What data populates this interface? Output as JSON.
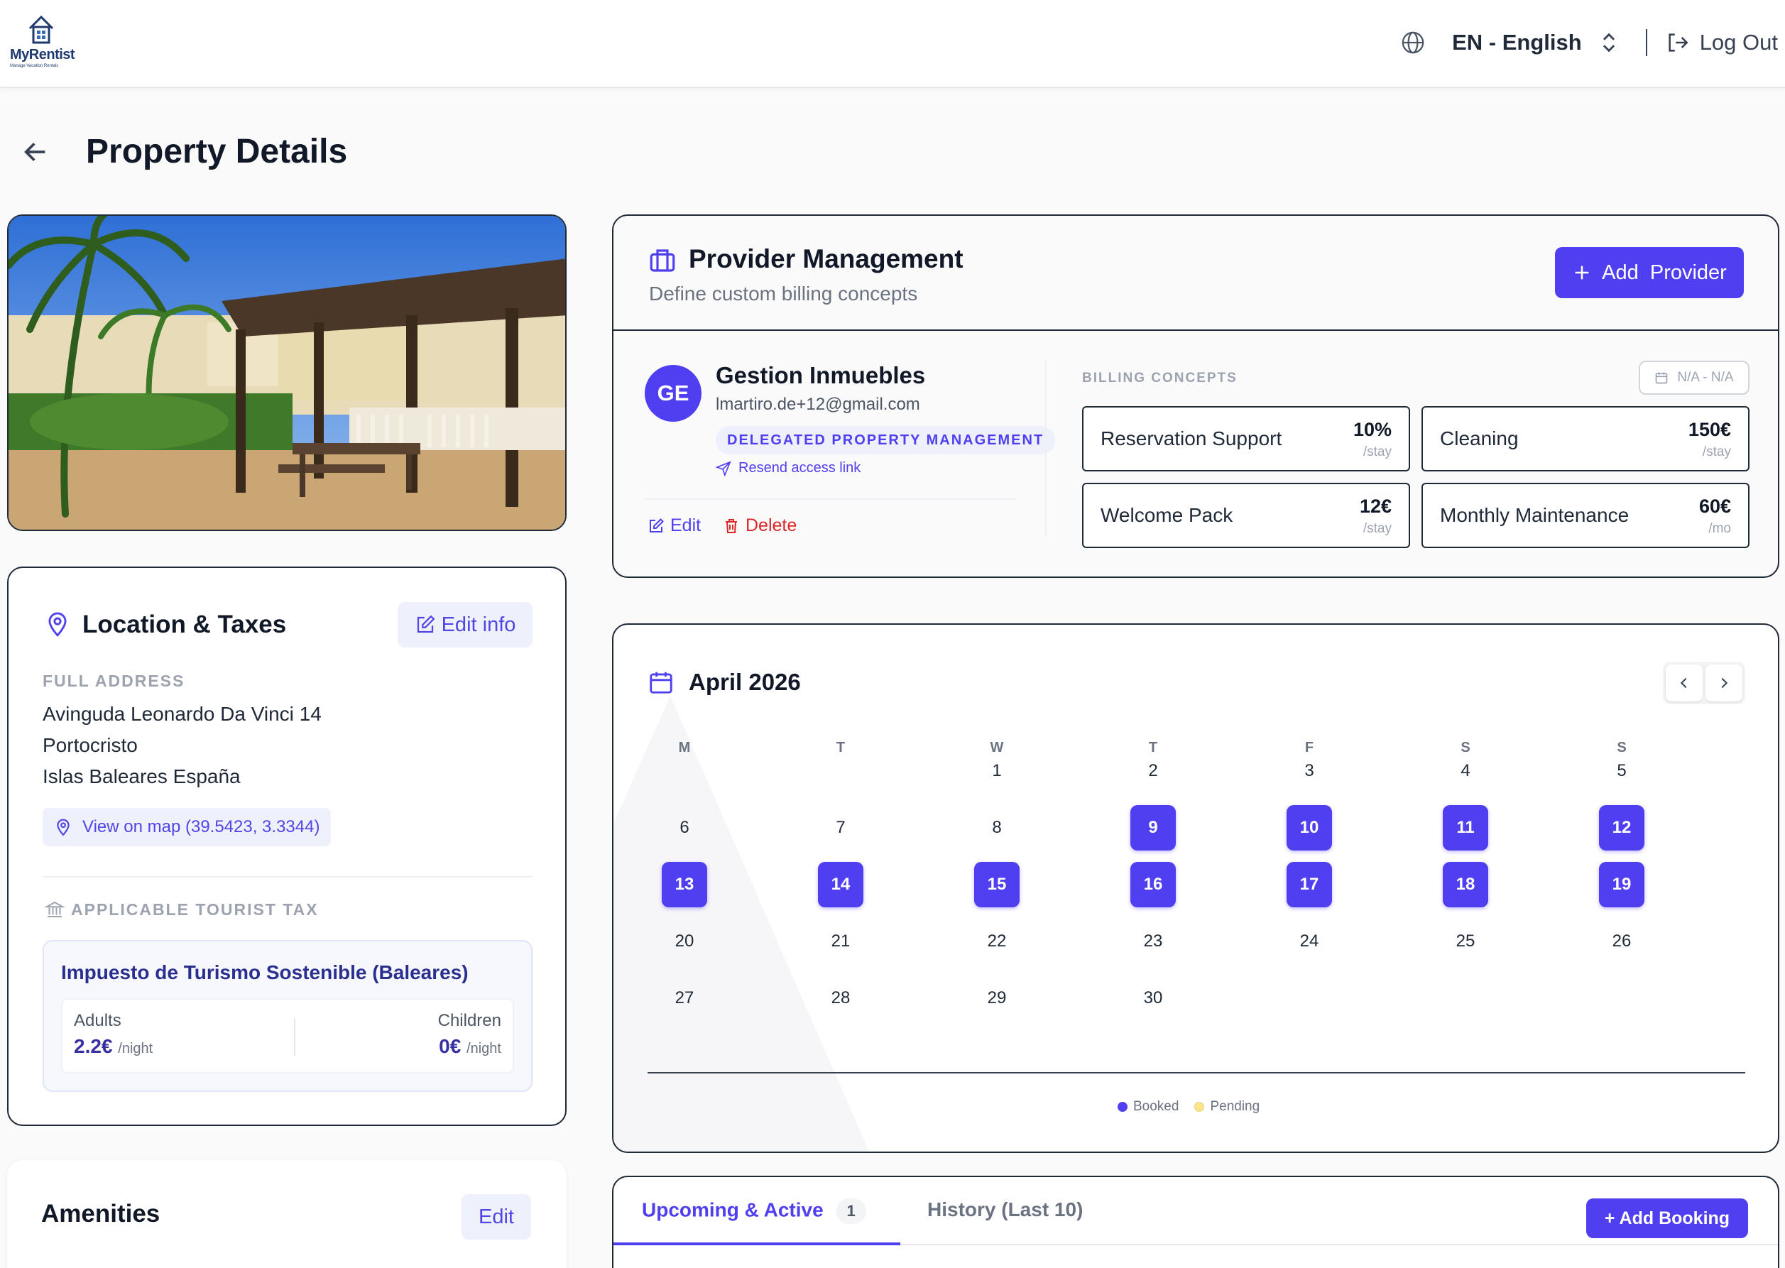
{
  "app": {
    "brand": "MyRentist",
    "tagline": "Manage Vacation Rentals",
    "language": "EN - English",
    "logout": "Log Out"
  },
  "page": {
    "title": "Property Details"
  },
  "location": {
    "title": "Location & Taxes",
    "edit_label": "Edit info",
    "address_label": "FULL ADDRESS",
    "address_lines": [
      "Avinguda Leonardo Da Vinci 14",
      "Portocristo",
      "Islas Baleares España"
    ],
    "map_link": "View on map (39.5423, 3.3344)",
    "tax_label": "APPLICABLE TOURIST TAX",
    "tax_name": "Impuesto de Turismo Sostenible (Baleares)",
    "adults_label": "Adults",
    "adults_value": "2.2€",
    "children_label": "Children",
    "children_value": "0€",
    "per_night": "/night"
  },
  "amenities": {
    "title": "Amenities",
    "edit_label": "Edit"
  },
  "provider": {
    "title": "Provider Management",
    "subtitle": "Define custom billing concepts",
    "add_label": "Add  Provider",
    "initials": "GE",
    "name": "Gestion Inmuebles",
    "email": "lmartiro.de+12@gmail.com",
    "badge": "DELEGATED PROPERTY MANAGEMENT",
    "resend": "Resend access link",
    "edit": "Edit",
    "delete": "Delete",
    "billing_title": "BILLING CONCEPTS",
    "date_range": "N/A - N/A",
    "concepts": [
      {
        "name": "Reservation Support",
        "value": "10%",
        "unit": "/stay"
      },
      {
        "name": "Cleaning",
        "value": "150€",
        "unit": "/stay"
      },
      {
        "name": "Welcome Pack",
        "value": "12€",
        "unit": "/stay"
      },
      {
        "name": "Monthly Maintenance",
        "value": "60€",
        "unit": "/mo"
      }
    ]
  },
  "calendar": {
    "month": "April 2026",
    "weekdays": [
      "M",
      "T",
      "W",
      "T",
      "F",
      "S",
      "S"
    ],
    "first_weekday_index": 2,
    "days_in_month": 30,
    "booked_days": [
      9,
      10,
      11,
      12,
      13,
      14,
      15,
      16,
      17,
      18,
      19
    ],
    "legend_booked": "Booked",
    "legend_pending": "Pending",
    "colors": {
      "booked": "#4f3ff0",
      "pending": "#fde68a"
    }
  },
  "bookings": {
    "tab_active": "Upcoming & Active",
    "tab_active_count": "1",
    "tab_history": "History (Last 10)",
    "add_label": "+ Add Booking"
  }
}
